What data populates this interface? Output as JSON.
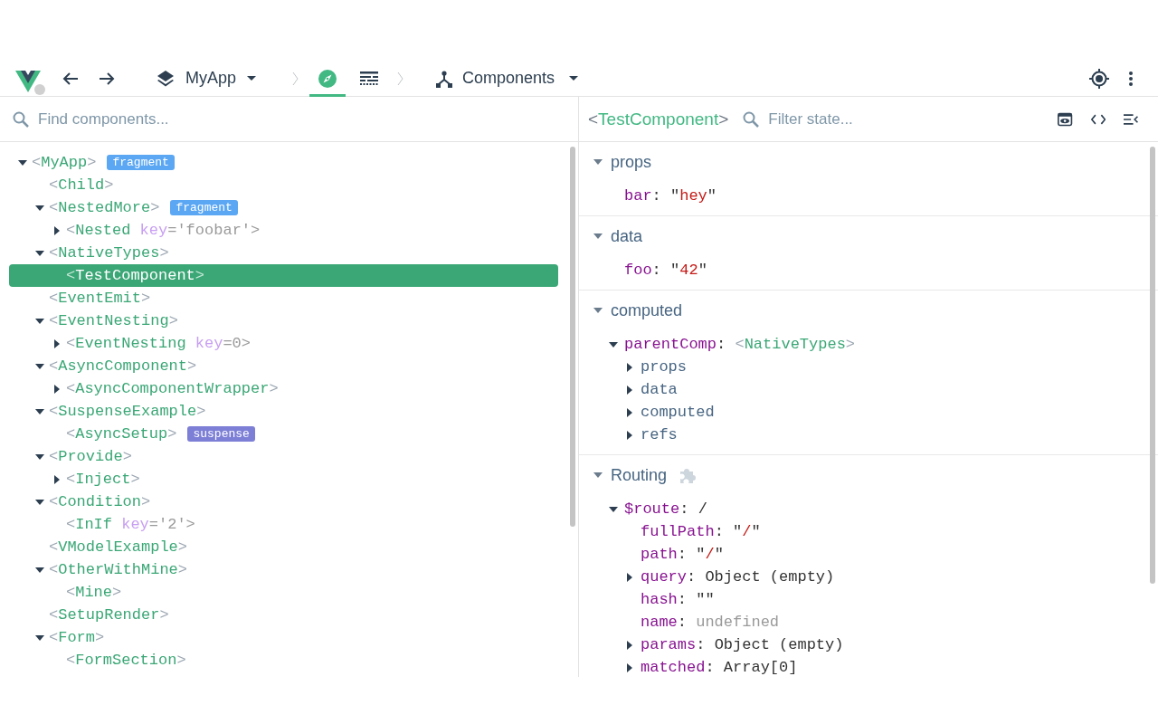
{
  "toolbar": {
    "app": {
      "label": "MyApp"
    },
    "tabs": [
      {
        "kind": "inspector",
        "selected": true
      },
      {
        "kind": "timeline",
        "selected": false
      }
    ],
    "section": {
      "label": "Components"
    }
  },
  "component_search": {
    "placeholder": "Find components..."
  },
  "tree": [
    {
      "tag": "<MyApp>",
      "expanded": true,
      "selected": false,
      "badge": {
        "label": "fragment",
        "color": "#5ba7f3"
      },
      "children": [
        {
          "tag": "<Child>",
          "selected": false
        },
        {
          "tag": "<NestedMore>",
          "expanded": true,
          "selected": false,
          "badge": {
            "label": "fragment",
            "color": "#5ba7f3"
          },
          "children": [
            {
              "tag": "<Nested",
              "attr_key": "key",
              "attr_value": "='foobar'>",
              "expanded": false,
              "selected": false
            }
          ]
        },
        {
          "tag": "<NativeTypes>",
          "expanded": true,
          "selected": false,
          "children": [
            {
              "tag": "<TestComponent>",
              "selected": true
            }
          ]
        },
        {
          "tag": "<EventEmit>",
          "selected": false
        },
        {
          "tag": "<EventNesting>",
          "expanded": true,
          "selected": false,
          "children": [
            {
              "tag": "<EventNesting",
              "attr_key": "key",
              "attr_value": "=0>",
              "expanded": false,
              "selected": false
            }
          ]
        },
        {
          "tag": "<AsyncComponent>",
          "expanded": true,
          "selected": false,
          "children": [
            {
              "tag": "<AsyncComponentWrapper>",
              "expanded": false,
              "selected": false
            }
          ]
        },
        {
          "tag": "<SuspenseExample>",
          "expanded": true,
          "selected": false,
          "children": [
            {
              "tag": "<AsyncSetup>",
              "selected": false,
              "badge": {
                "label": "suspense",
                "color": "#7d7fd6"
              }
            }
          ]
        },
        {
          "tag": "<Provide>",
          "expanded": true,
          "selected": false,
          "children": [
            {
              "tag": "<Inject>",
              "expanded": false,
              "selected": false
            }
          ]
        },
        {
          "tag": "<Condition>",
          "expanded": true,
          "selected": false,
          "children": [
            {
              "tag": "<InIf",
              "attr_key": "key",
              "attr_value": "='2'>",
              "selected": false
            }
          ]
        },
        {
          "tag": "<VModelExample>",
          "selected": false
        },
        {
          "tag": "<OtherWithMine>",
          "expanded": true,
          "selected": false,
          "children": [
            {
              "tag": "<Mine>",
              "selected": false
            }
          ]
        },
        {
          "tag": "<SetupRender>",
          "selected": false
        },
        {
          "tag": "<Form>",
          "expanded": true,
          "selected": false,
          "children": [
            {
              "tag": "<FormSection>",
              "selected": false
            }
          ]
        }
      ]
    }
  ],
  "inspector": {
    "title": "<TestComponent>",
    "filter": {
      "placeholder": "Filter state..."
    },
    "sections": [
      {
        "title": "props",
        "expanded": true,
        "plugin": false,
        "items": [
          {
            "key": "bar:",
            "value": "\"hey\"",
            "kind": "string"
          }
        ]
      },
      {
        "title": "data",
        "expanded": true,
        "plugin": false,
        "items": [
          {
            "key": "foo:",
            "value": "\"42\"",
            "kind": "string"
          }
        ]
      },
      {
        "title": "computed",
        "expanded": true,
        "plugin": false,
        "items": [
          {
            "key": "parentComp:",
            "value": "<NativeTypes>",
            "kind": "component",
            "expanded": true,
            "children": [
              {
                "key": "props",
                "kind": "group",
                "expanded": false
              },
              {
                "key": "data",
                "kind": "group",
                "expanded": false
              },
              {
                "key": "computed",
                "kind": "group",
                "expanded": false
              },
              {
                "key": "refs",
                "kind": "group",
                "expanded": false
              }
            ]
          }
        ]
      },
      {
        "title": "Routing",
        "expanded": true,
        "plugin": true,
        "items": [
          {
            "key": "$route:",
            "value": "/",
            "kind": "plain",
            "expanded": true,
            "children": [
              {
                "key": "fullPath:",
                "value": "\"/\"",
                "kind": "string"
              },
              {
                "key": "path:",
                "value": "\"/\"",
                "kind": "string"
              },
              {
                "key": "query:",
                "value": "Object (empty)",
                "kind": "plain",
                "expanded": false
              },
              {
                "key": "hash:",
                "value": "\"\"",
                "kind": "string"
              },
              {
                "key": "name:",
                "value": "undefined",
                "kind": "undefined"
              },
              {
                "key": "params:",
                "value": "Object (empty)",
                "kind": "plain",
                "expanded": false
              },
              {
                "key": "matched:",
                "value": "Array[0]",
                "kind": "plain",
                "expanded": false
              }
            ]
          }
        ]
      }
    ]
  }
}
